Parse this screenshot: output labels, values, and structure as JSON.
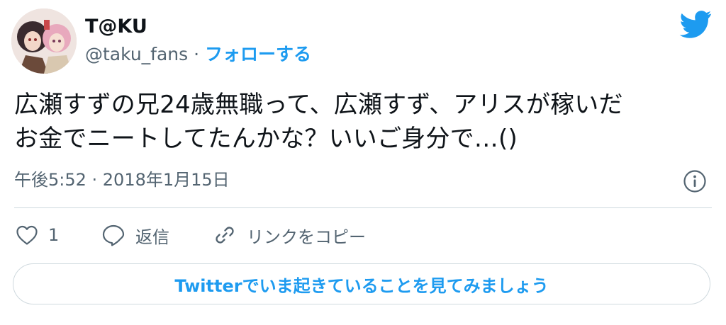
{
  "author": {
    "display_name": "T@KU",
    "handle": "@taku_fans",
    "separator": "·",
    "follow_label": "フォローする"
  },
  "tweet": {
    "line1": "広瀬すずの兄24歳無職って、広瀬すず、アリスが稼いだ",
    "line2": "お金でニートしてたんかな？いいご身分で…()"
  },
  "meta": {
    "timestamp": "午後5:52 · 2018年1月15日"
  },
  "actions": {
    "like_count": "1",
    "reply_label": "返信",
    "copy_link_label": "リンクをコピー"
  },
  "cta": {
    "label": "Twitterでいま起きていることを見てみましょう"
  },
  "colors": {
    "accent": "#1d9bf0",
    "secondary_text": "#536471",
    "border": "#cfd9de"
  },
  "icons": [
    "twitter-bird-icon",
    "info-icon",
    "heart-icon",
    "reply-icon",
    "link-icon"
  ]
}
